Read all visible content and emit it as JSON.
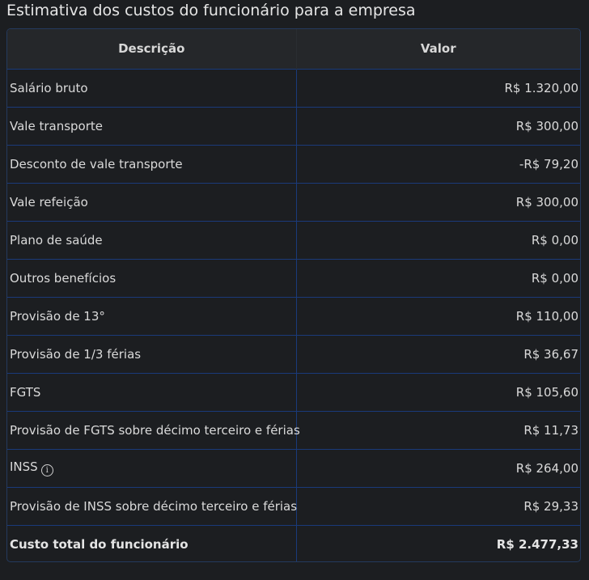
{
  "title": "Estimativa dos custos do funcionário para a empresa",
  "table": {
    "headers": {
      "description": "Descrição",
      "value": "Valor"
    },
    "rows": [
      {
        "label": "Salário bruto",
        "value": "R$ 1.320,00"
      },
      {
        "label": "Vale transporte",
        "value": "R$ 300,00"
      },
      {
        "label": "Desconto de vale transporte",
        "value": "-R$ 79,20"
      },
      {
        "label": "Vale refeição",
        "value": "R$ 300,00"
      },
      {
        "label": "Plano de saúde",
        "value": "R$ 0,00"
      },
      {
        "label": "Outros benefícios",
        "value": "R$ 0,00"
      },
      {
        "label": "Provisão de 13°",
        "value": "R$ 110,00"
      },
      {
        "label": "Provisão de 1/3 férias",
        "value": "R$ 36,67"
      },
      {
        "label": "FGTS",
        "value": "R$ 105,60"
      },
      {
        "label": "Provisão de FGTS sobre décimo terceiro e férias",
        "value": "R$ 11,73"
      },
      {
        "label": "INSS",
        "value": "R$ 264,00",
        "icon": "info-icon",
        "icon_glyph": "i"
      },
      {
        "label": "Provisão de INSS sobre décimo terceiro e férias",
        "value": "R$ 29,33"
      }
    ],
    "total": {
      "label": "Custo total do funcionário",
      "value": "R$ 2.477,33"
    }
  }
}
